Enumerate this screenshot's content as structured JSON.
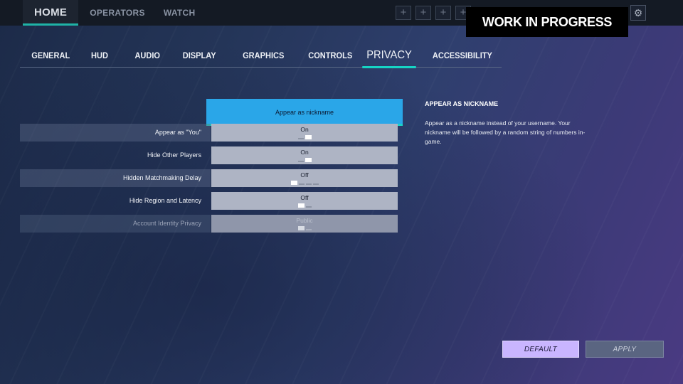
{
  "topnav": {
    "items": [
      {
        "label": "HOME"
      },
      {
        "label": "OPERATORS"
      },
      {
        "label": "WATCH"
      }
    ]
  },
  "squad": {
    "slots": [
      "+",
      "+",
      "+",
      "+"
    ]
  },
  "banner": {
    "text": "WORK IN PROGRESS"
  },
  "icons": {
    "gear": "gear-icon"
  },
  "tabs": [
    {
      "label": "GENERAL"
    },
    {
      "label": "HUD"
    },
    {
      "label": "AUDIO"
    },
    {
      "label": "DISPLAY"
    },
    {
      "label": "GRAPHICS"
    },
    {
      "label": "CONTROLS"
    },
    {
      "label": "PRIVACY"
    },
    {
      "label": "ACCESSIBILITY"
    }
  ],
  "active_tab": "PRIVACY",
  "settings": {
    "highlighted_label": "Appear as nickname",
    "rows": [
      {
        "label": "Appear as \"You\"",
        "value": "On",
        "option_count": 2,
        "selected_index": 1,
        "enabled": true
      },
      {
        "label": "Hide Other Players",
        "value": "On",
        "option_count": 2,
        "selected_index": 1,
        "enabled": true
      },
      {
        "label": "Hidden Matchmaking Delay",
        "value": "Off",
        "option_count": 4,
        "selected_index": 0,
        "enabled": true
      },
      {
        "label": "Hide Region and Latency",
        "value": "Off",
        "option_count": 2,
        "selected_index": 0,
        "enabled": true
      },
      {
        "label": "Account Identity Privacy",
        "value": "Public",
        "option_count": 2,
        "selected_index": 0,
        "enabled": false
      }
    ]
  },
  "description": {
    "title": "APPEAR AS NICKNAME",
    "body": "Appear as a nickname instead of your username. Your nickname will be followed by a random string of numbers in-game."
  },
  "buttons": {
    "default": "DEFAULT",
    "apply": "APPLY"
  },
  "colors": {
    "accent_teal": "#16d4c4",
    "highlight_blue": "#2aa6e8",
    "default_button": "#c9b5ff"
  }
}
